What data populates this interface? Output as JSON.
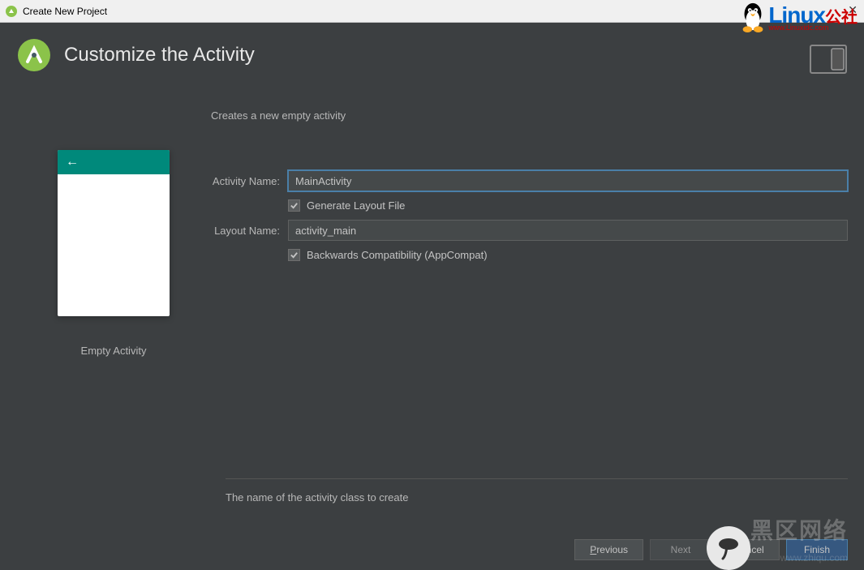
{
  "window": {
    "title": "Create New Project"
  },
  "header": {
    "title": "Customize the Activity"
  },
  "preview": {
    "label": "Empty Activity"
  },
  "form": {
    "description": "Creates a new empty activity",
    "activityNameLabel": "Activity Name:",
    "activityName": "MainActivity",
    "generateLayoutLabel": "Generate Layout File",
    "layoutNameLabel": "Layout Name:",
    "layoutName": "activity_main",
    "backwardsCompatLabel": "Backwards Compatibility (AppCompat)",
    "helpText": "The name of the activity class to create"
  },
  "buttons": {
    "previous": "Previous",
    "next": "Next",
    "cancel": "Cancel",
    "finish": "Finish"
  },
  "overlay": {
    "linuxText": "Linux",
    "linuxSuffix": "公社",
    "linuxSub": "www.Linuxidc.com",
    "watermark": "黑区网络",
    "watermarkSub": "www.zhiqu.com"
  }
}
